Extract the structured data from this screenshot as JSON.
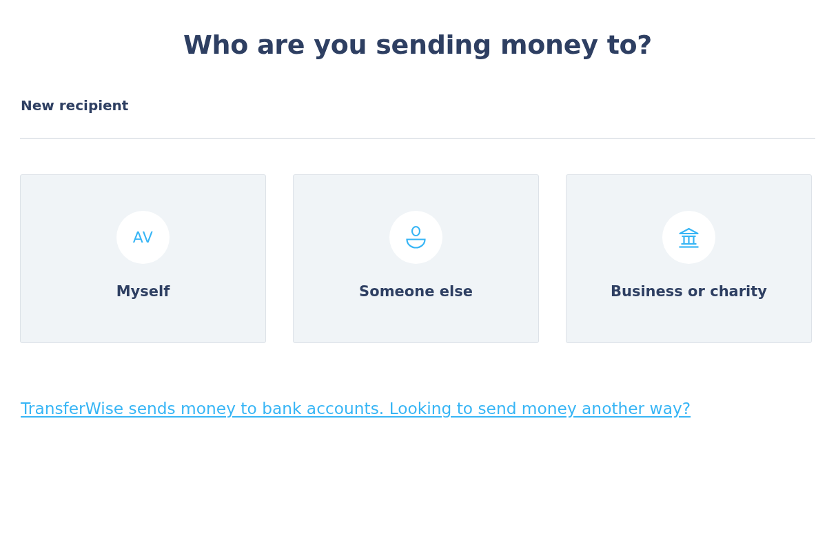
{
  "title": "Who are you sending money to?",
  "section": {
    "label": "New recipient"
  },
  "options": [
    {
      "kind": "initials",
      "initials": "AV",
      "label": "Myself"
    },
    {
      "kind": "person",
      "label": "Someone else"
    },
    {
      "kind": "bank",
      "label": "Business or charity"
    }
  ],
  "footer_link": "TransferWise sends money to bank accounts. Looking to send money another way?"
}
